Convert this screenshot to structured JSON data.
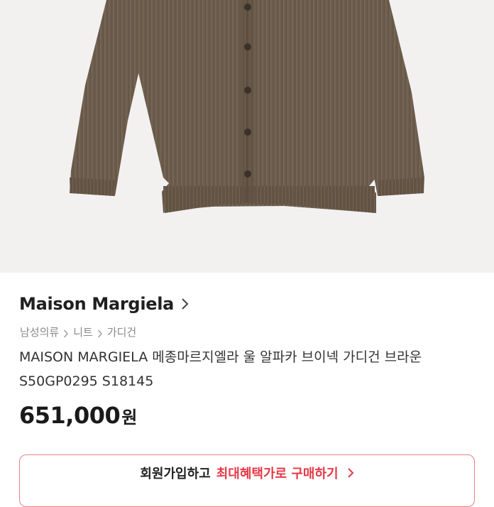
{
  "product": {
    "brand": "Maison Margiela",
    "breadcrumb": [
      "남성의류",
      "니트",
      "가디건"
    ],
    "title": "MAISON MARGIELA 메종마르지엘라 울 알파카 브이넥 가디건 브라운 S50GP0295 S18145",
    "price": "651,000",
    "price_unit": "원",
    "image_subject": "brown knit cardigan"
  },
  "cta": {
    "text1": "회원가입하고",
    "text2": "최대혜택가로 구매하기"
  },
  "colors": {
    "accent": "#e63946",
    "button_border": "#ee7f87",
    "image_bg": "#f2f1f0",
    "knit": "#6e5e4f"
  },
  "icons": {
    "brand_link": "chevron-right-icon",
    "breadcrumb_separator": "chevron-right-icon",
    "cta": "chevron-right-icon"
  }
}
